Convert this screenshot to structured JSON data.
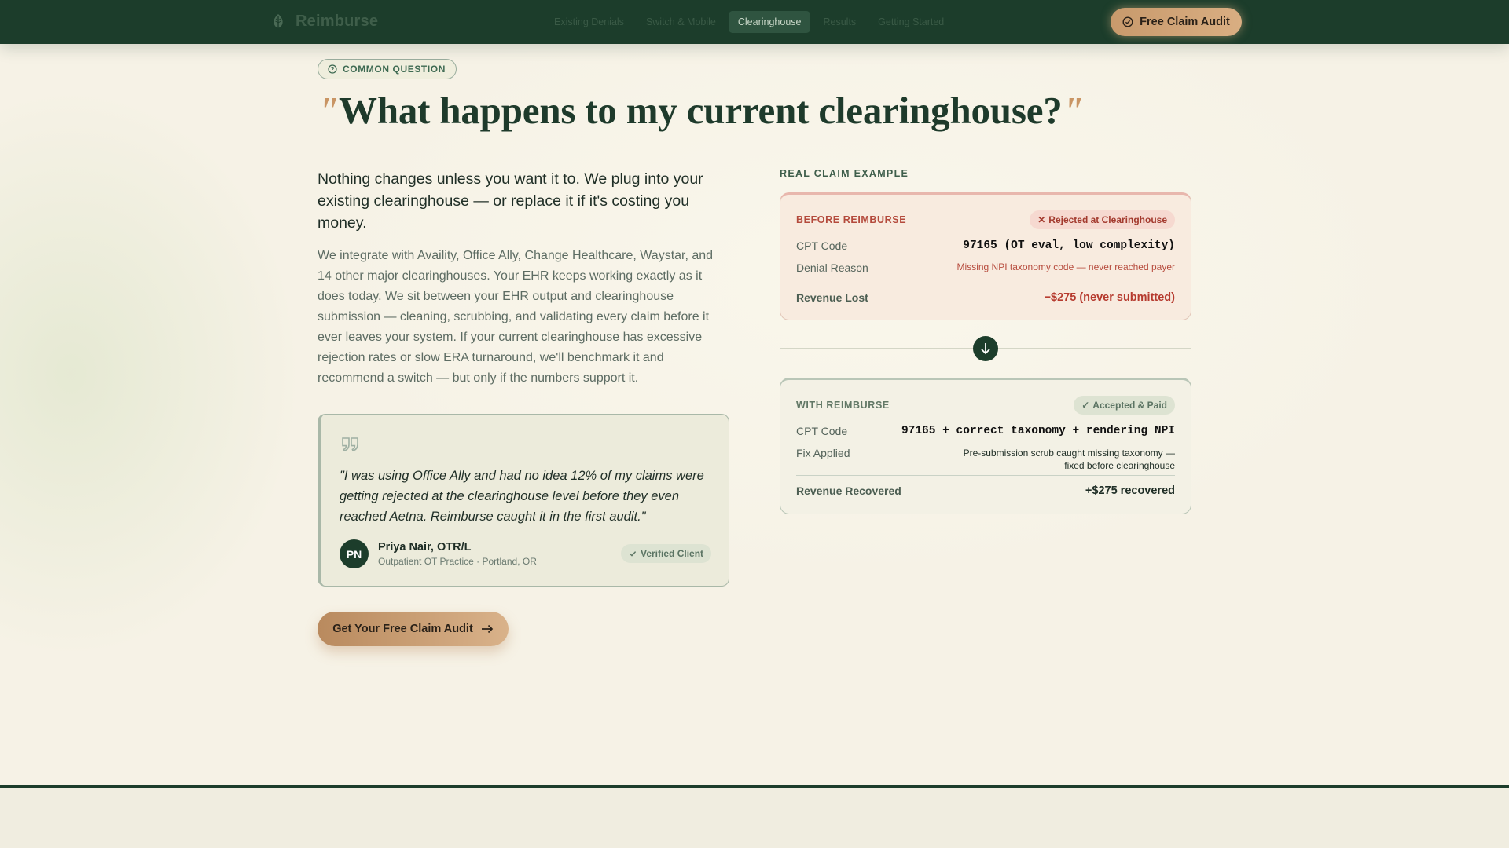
{
  "nav": {
    "brand": "Reimburse",
    "links": [
      "Existing Denials",
      "Switch & Mobile",
      "Clearinghouse",
      "Results",
      "Getting Started"
    ],
    "active_index": 2,
    "cta": "Free Claim Audit"
  },
  "badge": "COMMON QUESTION",
  "headline": {
    "open_quote": "\"",
    "text": "What happens to my current clearinghouse?",
    "close_quote": "\""
  },
  "lead": "Nothing changes unless you want it to. We plug into your existing clearinghouse — or replace it if it's costing you money.",
  "body": "We integrate with Availity, Office Ally, Change Healthcare, Waystar, and 14 other major clearinghouses. Your EHR keeps working exactly as it does today. We sit between your EHR output and clearinghouse submission — cleaning, scrubbing, and validating every claim before it ever leaves your system. If your current clearinghouse has excessive rejection rates or slow ERA turnaround, we'll benchmark it and recommend a switch — but only if the numbers support it.",
  "testimonial": {
    "quote": "\"I was using Office Ally and had no idea 12% of my claims were getting rejected at the clearinghouse level before they even reached Aetna. Reimburse caught it in the first audit.\"",
    "initials": "PN",
    "name": "Priya Nair, OTR/L",
    "role": "Outpatient OT Practice · Portland, OR",
    "verified": "Verified Client"
  },
  "cta_main": "Get Your Free Claim Audit",
  "example": {
    "label": "REAL CLAIM EXAMPLE",
    "before": {
      "title": "BEFORE REIMBURSE",
      "status": "Rejected at Clearinghouse",
      "cpt_label": "CPT Code",
      "cpt_value": "97165 (OT eval, low complexity)",
      "denial_label": "Denial Reason",
      "denial_value": "Missing NPI taxonomy code — never reached payer",
      "revenue_label": "Revenue Lost",
      "revenue_value": "−$275 (never submitted)"
    },
    "after": {
      "title": "WITH REIMBURSE",
      "status": "Accepted & Paid",
      "cpt_label": "CPT Code",
      "cpt_value": "97165 + correct taxonomy + rendering NPI",
      "fix_label": "Fix Applied",
      "fix_value": "Pre-submission scrub caught missing taxonomy — fixed before clearinghouse",
      "revenue_label": "Revenue Recovered",
      "revenue_value": "+$275 recovered"
    }
  },
  "colors": {
    "forest": "#1c3d2b",
    "cream": "#f6f2e6",
    "accent_tan": "#c99564",
    "reject_red": "#b44a3c"
  }
}
